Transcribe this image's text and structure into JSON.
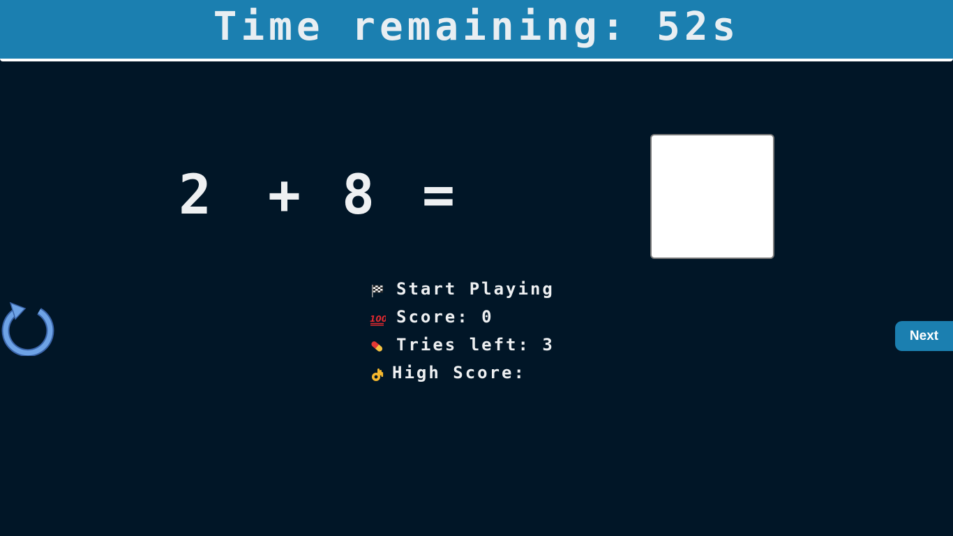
{
  "timer": {
    "label": "Time remaining: 52s"
  },
  "equation": {
    "operand_a": "2",
    "operator": "+",
    "operand_b": "8",
    "equals": "="
  },
  "answer": {
    "value": ""
  },
  "stats": {
    "status": "Start Playing",
    "score": "Score: 0",
    "tries": "Tries left: 3",
    "high_score": "High Score:"
  },
  "icons": {
    "status": "checkered-flag-icon",
    "score": "hundred-points-icon",
    "tries": "pill-icon",
    "high_score": "ok-hand-icon",
    "restart": "restart-icon"
  },
  "buttons": {
    "next": "Next"
  },
  "colors": {
    "background": "#011627",
    "accent": "#1b7fb0",
    "text": "#eef0f2",
    "restart": "#6ea3e6"
  }
}
